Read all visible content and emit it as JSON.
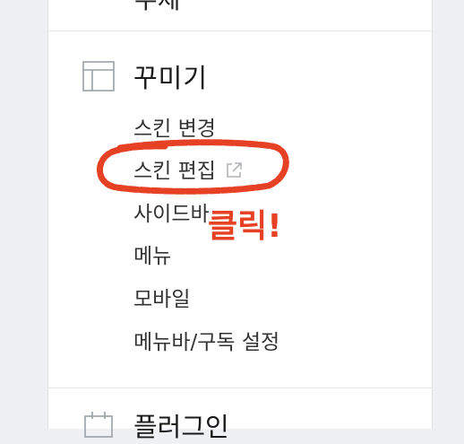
{
  "sidebar": {
    "previous_section": {
      "title": "주제",
      "icon": "stats-icon"
    },
    "current_section": {
      "title": "꾸미기",
      "icon": "layout-icon",
      "items": [
        {
          "label": "스킨 변경"
        },
        {
          "label": "스킨 편집",
          "icon": "external-link-icon"
        },
        {
          "label": "사이드바"
        },
        {
          "label": "메뉴"
        },
        {
          "label": "모바일"
        },
        {
          "label": "메뉴바/구독 설정"
        }
      ]
    },
    "next_section": {
      "title": "플러그인",
      "icon": "calendar-icon"
    }
  },
  "annotation": {
    "text": "클릭!",
    "color": "#e64125"
  }
}
